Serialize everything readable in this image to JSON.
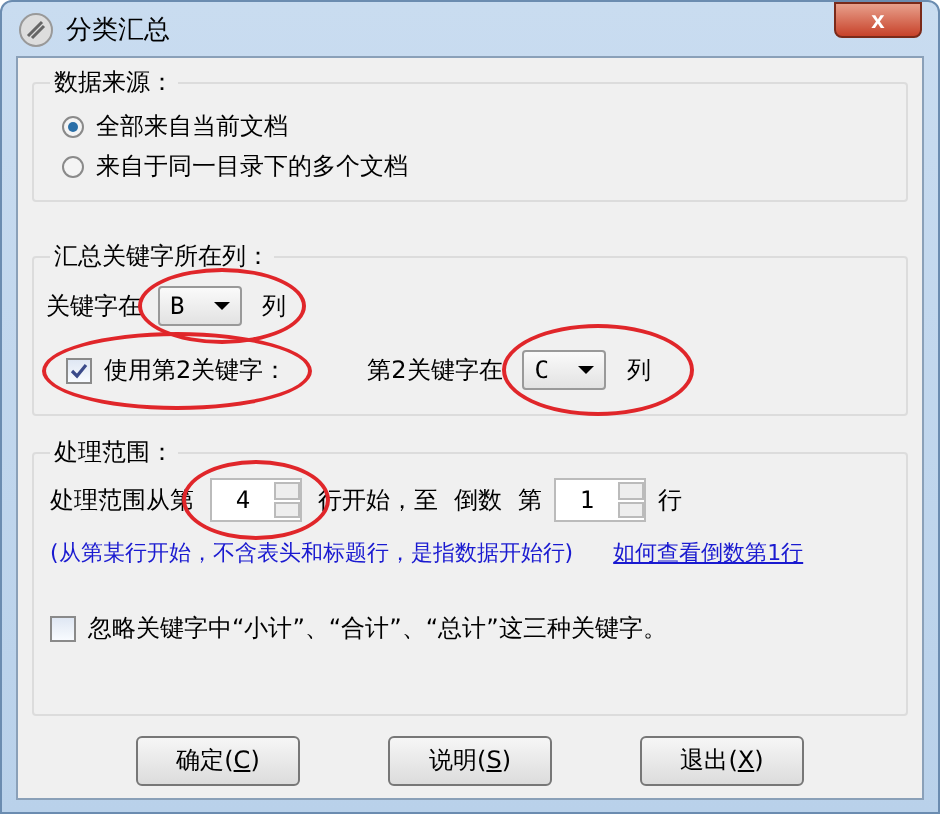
{
  "window": {
    "title": "分类汇总",
    "close": "x"
  },
  "source": {
    "legend": "数据来源：",
    "options": [
      {
        "label": "全部来自当前文档",
        "selected": true
      },
      {
        "label": "来自于同一目录下的多个文档",
        "selected": false
      }
    ]
  },
  "key_column": {
    "legend": "汇总关键字所在列：",
    "key_label": "关键字在",
    "key_value": "B",
    "key_unit": "列",
    "second_key": {
      "label": "使用第2关键字：",
      "checked": true
    },
    "second_label": "第2关键字在",
    "second_value": "C",
    "second_unit": "列"
  },
  "range": {
    "legend": "处理范围：",
    "from_label": "处理范围从第",
    "from_value": "4",
    "middle": "行开始，至",
    "reverse": "倒数",
    "nth": "第",
    "to_value": "1",
    "to_unit": "行",
    "note": "(从第某行开始，不含表头和标题行，是指数据开始行)",
    "help_link": "如何查看倒数第1行",
    "ignore": {
      "label": "忽略关键字中“小计”、“合计”、“总计”这三种关键字。",
      "checked": false
    }
  },
  "buttons": [
    {
      "pre": "确定(",
      "key": "C",
      "post": ")"
    },
    {
      "pre": "说明(",
      "key": "S",
      "post": ")"
    },
    {
      "pre": "退出(",
      "key": "X",
      "post": ")"
    }
  ]
}
